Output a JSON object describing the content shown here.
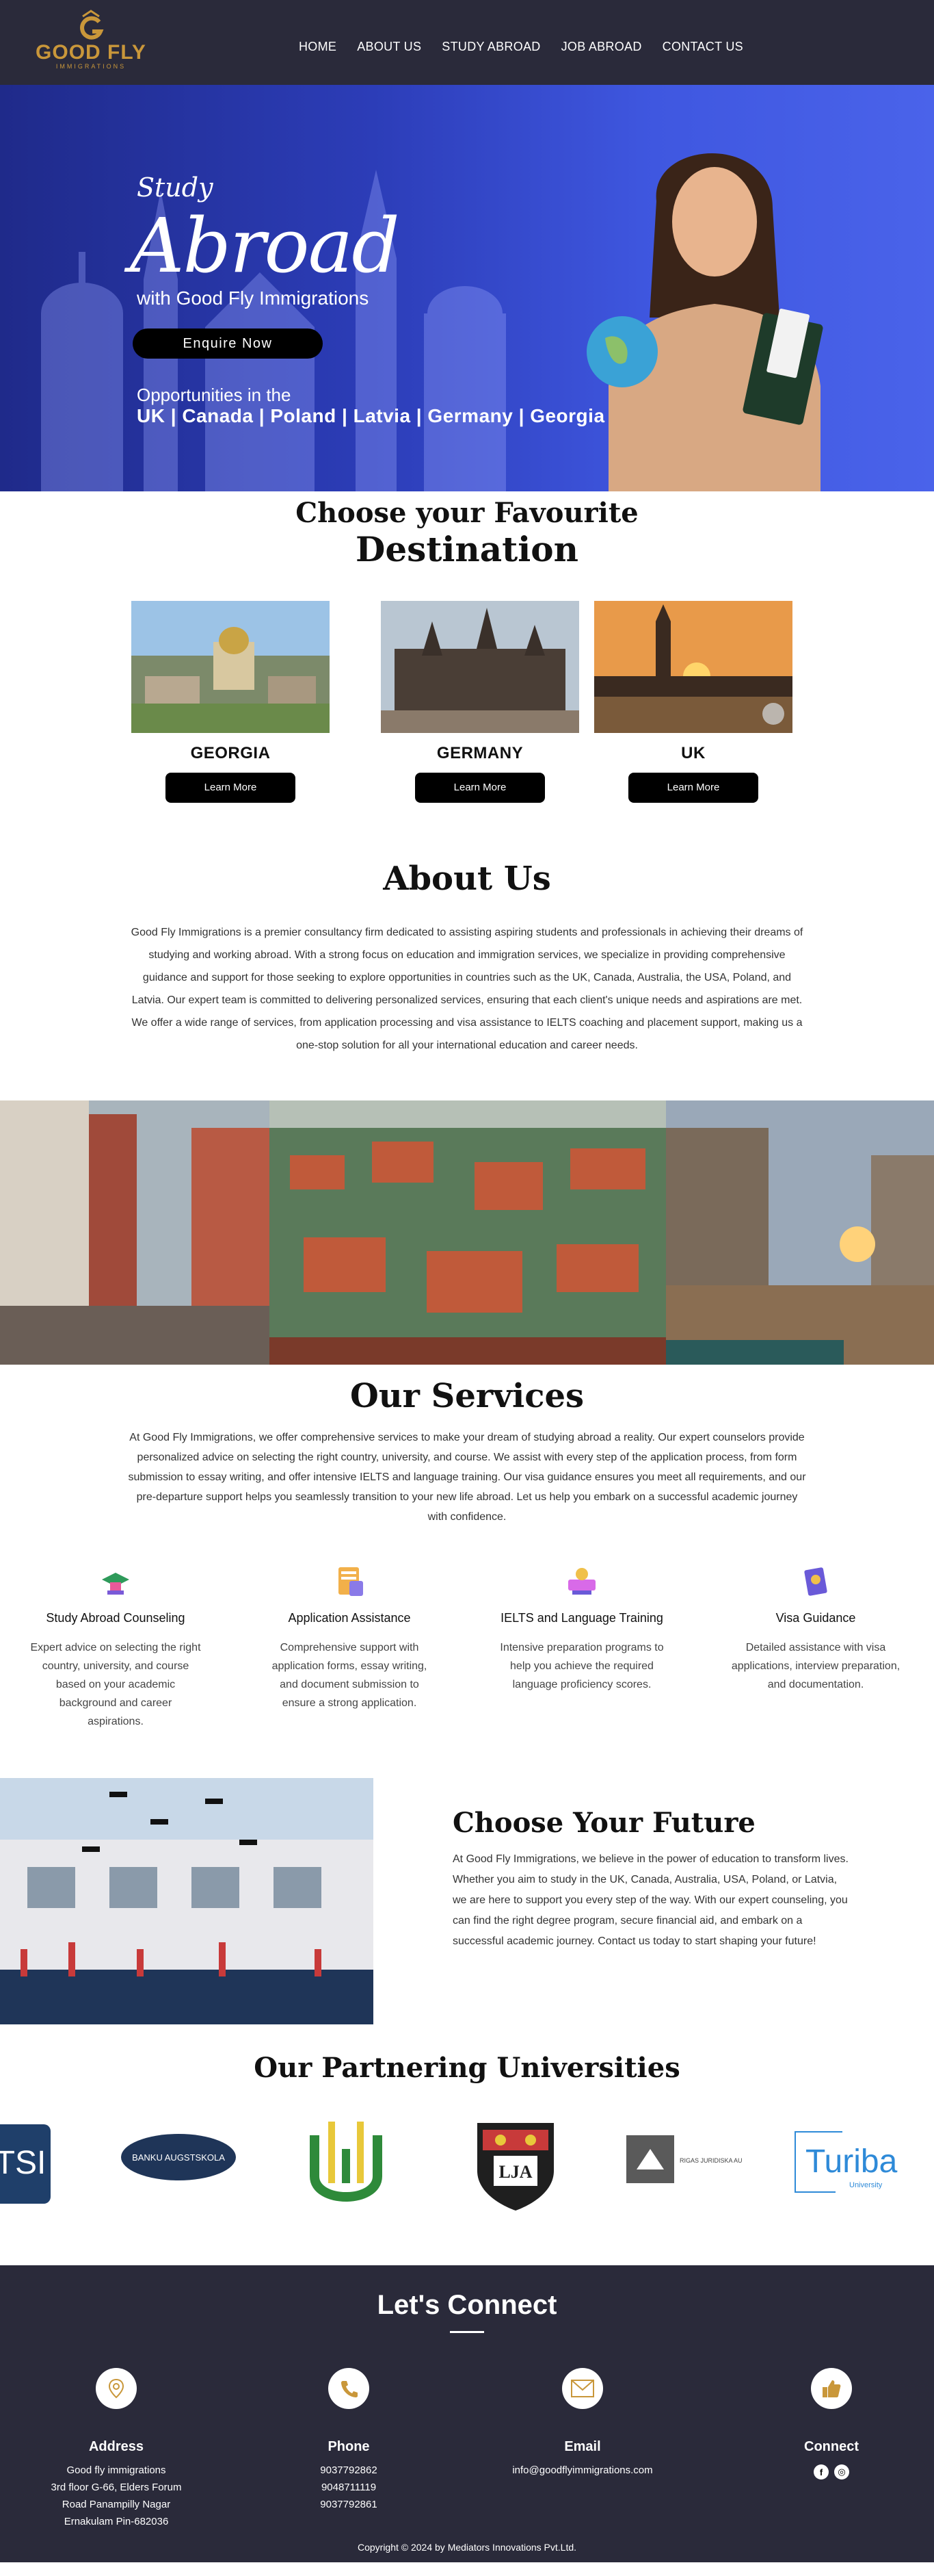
{
  "header": {
    "logo_text": "GOOD FLY",
    "logo_sub": "IMMIGRATIONS",
    "nav": [
      "HOME",
      "ABOUT US",
      "STUDY ABROAD",
      "JOB ABROAD",
      "CONTACT US"
    ]
  },
  "hero": {
    "study": "Study",
    "abroad": "Abroad",
    "with": "with Good Fly Immigrations",
    "button": "Enquire Now",
    "opps": "Opportunities in the",
    "countries": "UK | Canada | Poland | Latvia | Germany | Georgia"
  },
  "destinations": {
    "heading1": "Choose your Favourite",
    "heading2": "Destination",
    "cards": [
      {
        "name": "GEORGIA",
        "button": "Learn More"
      },
      {
        "name": "GERMANY",
        "button": "Learn More"
      },
      {
        "name": "UK",
        "button": "Learn More"
      }
    ]
  },
  "about": {
    "title": "About Us",
    "text": "Good Fly Immigrations is a premier consultancy firm dedicated to assisting aspiring students and professionals in achieving their dreams of studying and working abroad. With a strong focus on education and immigration services, we specialize in providing comprehensive guidance and support for those seeking to explore opportunities in countries such as the UK, Canada, Australia, the USA, Poland, and Latvia. Our expert team is committed to delivering personalized services, ensuring that each client's unique needs and aspirations are met. We offer a wide range of services, from application processing and visa assistance to IELTS coaching and placement support, making us a one-stop solution for all your international education and career needs."
  },
  "services": {
    "title": "Our Services",
    "intro": "At Good Fly Immigrations, we offer comprehensive services to make your dream of studying abroad a reality. Our expert counselors provide personalized advice on selecting the right country, university, and course. We assist with every step of the application process, from form submission to essay writing, and offer intensive IELTS and language training. Our visa guidance ensures you meet all requirements, and our pre-departure support helps you seamlessly transition to your new life abroad. Let us help you embark on a successful academic journey with confidence.",
    "items": [
      {
        "title": "Study Abroad Counseling",
        "desc": "Expert advice on selecting the right country, university, and course based on your academic background and career aspirations."
      },
      {
        "title": "Application Assistance",
        "desc": "Comprehensive support with application forms, essay writing, and document submission to ensure a strong application."
      },
      {
        "title": "IELTS and Language Training",
        "desc": "Intensive preparation programs to help you achieve the required language proficiency scores."
      },
      {
        "title": "Visa Guidance",
        "desc": "Detailed assistance with visa applications, interview preparation, and documentation."
      }
    ]
  },
  "future": {
    "title": "Choose Your Future",
    "text": "At Good Fly Immigrations, we believe in the power of education to transform lives. Whether you aim to study in the UK, Canada, Australia, USA, Poland, or Latvia, we are here to support you every step of the way. With our expert counseling, you can find the right degree program, secure financial aid, and embark on a successful academic journey. Contact us today to start shaping your future!"
  },
  "partners": {
    "title": "Our Partnering Universities",
    "logo_texts": [
      "TSI",
      "BANKU AUGSTSKOLA",
      "LJA",
      "RIGAS JURIDISKA AUGSTSKOLA",
      "Turiba",
      "University"
    ]
  },
  "connect": {
    "title": "Let's Connect",
    "address_title": "Address",
    "address_lines": [
      "Good fly immigrations",
      "3rd floor G-66, Elders Forum",
      "Road  Panampilly Nagar",
      "Ernakulam Pin-682036"
    ],
    "phone_title": "Phone",
    "phones": [
      "9037792862",
      "9048711119",
      "9037792861"
    ],
    "email_title": "Email",
    "email": "info@goodflyimmigrations.com",
    "connect_title": "Connect",
    "copyright": "Copyright © 2024 by Mediators Innovations Pvt.Ltd."
  },
  "colors": {
    "header_bg": "#2a2a3a",
    "brand_gold": "#c9973a",
    "hero_blue": "#3f57e0",
    "button_black": "#000000"
  },
  "icons": [
    "location-icon",
    "phone-icon",
    "email-icon",
    "thumbs-up-icon",
    "facebook-icon",
    "instagram-icon"
  ]
}
